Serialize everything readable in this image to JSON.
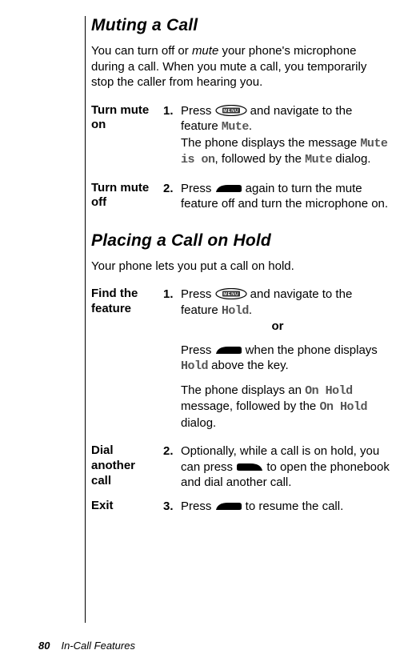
{
  "sections": [
    {
      "title": "Muting a Call",
      "intro_a": "You can turn off or ",
      "intro_em": "mute",
      "intro_b": " your phone's microphone during a call. When you mute a call, you temporarily stop the caller from hearing you.",
      "rows": [
        {
          "label": "Turn mute on",
          "num": "1.",
          "txt_a": "Press ",
          "btn": "menu",
          "txt_b": " and navigate to the feature ",
          "mono1": "Mute",
          "txt_c": ".",
          "para_a": "The phone displays the message ",
          "mono2": "Mute is on",
          "para_b": ", followed by the ",
          "mono3": "Mute",
          "para_c": " dialog."
        },
        {
          "label": "Turn mute off",
          "num": "2.",
          "txt_a": "Press ",
          "btn": "soft",
          "txt_b": " again to turn the mute feature off and turn the microphone on."
        }
      ]
    },
    {
      "title": "Placing a Call on Hold",
      "intro_a": "Your phone lets you put a call on hold.",
      "rows": [
        {
          "label": "Find the feature",
          "num": "1.",
          "txt_a": "Press ",
          "btn": "menu",
          "txt_b": " and navigate to the feature ",
          "mono1": "Hold",
          "txt_c": ".",
          "or": "or",
          "para2_a": "Press ",
          "btn2": "soft",
          "para2_b": " when the phone displays ",
          "mono2": "Hold",
          "para2_c": " above the key.",
          "para3_a": "The phone displays an ",
          "mono3": "On Hold",
          "para3_b": " message, followed by the ",
          "mono4": "On Hold",
          "para3_c": " dialog."
        },
        {
          "label": "Dial another call",
          "num": "2.",
          "txt_a": "Optionally, while a call is on hold, you can press ",
          "btn": "soft-left",
          "txt_b": " to open the phonebook and dial another call."
        },
        {
          "label": "Exit",
          "num": "3.",
          "txt_a": "Press ",
          "btn": "soft",
          "txt_b": " to resume the call."
        }
      ]
    }
  ],
  "footer": {
    "page": "80",
    "title": "In-Call Features"
  }
}
